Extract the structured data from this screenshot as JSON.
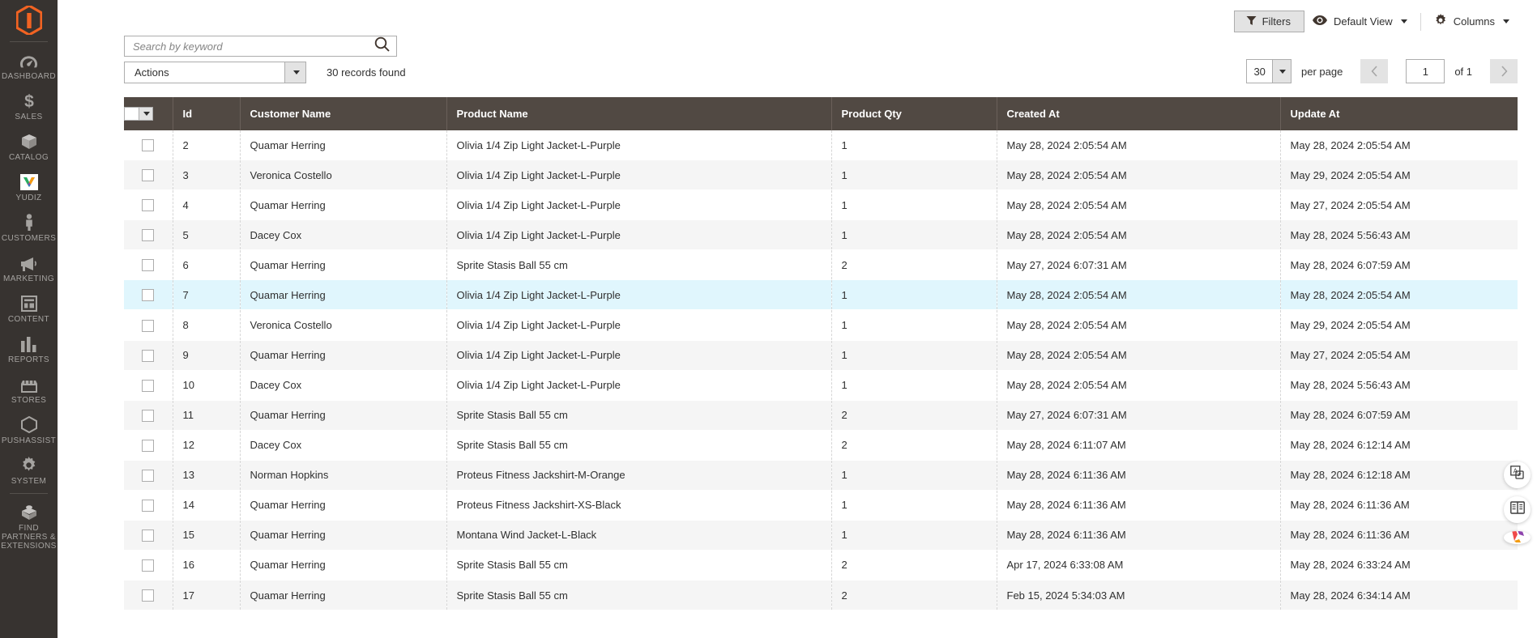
{
  "sidebar": {
    "logo": "magento-logo",
    "items": [
      {
        "label": "DASHBOARD",
        "icon": "dashboard-gauge-icon"
      },
      {
        "label": "SALES",
        "icon": "dollar-sign-icon"
      },
      {
        "label": "CATALOG",
        "icon": "box-icon"
      },
      {
        "label": "YUDIZ",
        "icon": "yudiz-logo-icon"
      },
      {
        "label": "CUSTOMERS",
        "icon": "person-icon"
      },
      {
        "label": "MARKETING",
        "icon": "megaphone-icon"
      },
      {
        "label": "CONTENT",
        "icon": "layout-panel-icon"
      },
      {
        "label": "REPORTS",
        "icon": "bar-chart-icon"
      },
      {
        "label": "STORES",
        "icon": "storefront-icon"
      },
      {
        "label": "PUSHASSIST",
        "icon": "hexagon-icon"
      },
      {
        "label": "SYSTEM",
        "icon": "gear-icon"
      },
      {
        "label": "FIND PARTNERS & EXTENSIONS",
        "icon": "extension-box-icon"
      }
    ]
  },
  "toolbar": {
    "filters_label": "Filters",
    "filters_icon": "funnel-icon",
    "view_label": "Default View",
    "view_icon": "eye-icon",
    "columns_label": "Columns",
    "columns_icon": "gear-icon"
  },
  "search": {
    "placeholder": "Search by keyword",
    "value": "",
    "icon": "search-icon"
  },
  "actions": {
    "label": "Actions",
    "records_found": "30 records found"
  },
  "pager": {
    "per_page_value": "30",
    "per_page_label": "per page",
    "prev_icon": "chevron-left-icon",
    "next_icon": "chevron-right-icon",
    "page_value": "1",
    "of_label": "of 1"
  },
  "grid": {
    "columns": [
      {
        "key": "cb",
        "label": ""
      },
      {
        "key": "id",
        "label": "Id"
      },
      {
        "key": "cust",
        "label": "Customer Name"
      },
      {
        "key": "prod",
        "label": "Product Name"
      },
      {
        "key": "qty",
        "label": "Product Qty"
      },
      {
        "key": "cre",
        "label": "Created At"
      },
      {
        "key": "upd",
        "label": "Update At"
      }
    ],
    "rows": [
      {
        "id": "2",
        "cust": "Quamar Herring",
        "prod": "Olivia 1/4 Zip Light Jacket-L-Purple",
        "qty": "1",
        "cre": "May 28, 2024 2:05:54 AM",
        "upd": "May 28, 2024 2:05:54 AM",
        "state": "odd"
      },
      {
        "id": "3",
        "cust": "Veronica Costello",
        "prod": "Olivia 1/4 Zip Light Jacket-L-Purple",
        "qty": "1",
        "cre": "May 28, 2024 2:05:54 AM",
        "upd": "May 29, 2024 2:05:54 AM",
        "state": "even"
      },
      {
        "id": "4",
        "cust": "Quamar Herring",
        "prod": "Olivia 1/4 Zip Light Jacket-L-Purple",
        "qty": "1",
        "cre": "May 28, 2024 2:05:54 AM",
        "upd": "May 27, 2024 2:05:54 AM",
        "state": "odd"
      },
      {
        "id": "5",
        "cust": "Dacey Cox",
        "prod": "Olivia 1/4 Zip Light Jacket-L-Purple",
        "qty": "1",
        "cre": "May 28, 2024 2:05:54 AM",
        "upd": "May 28, 2024 5:56:43 AM",
        "state": "even"
      },
      {
        "id": "6",
        "cust": "Quamar Herring",
        "prod": "Sprite Stasis Ball 55 cm",
        "qty": "2",
        "cre": "May 27, 2024 6:07:31 AM",
        "upd": "May 28, 2024 6:07:59 AM",
        "state": "odd"
      },
      {
        "id": "7",
        "cust": "Quamar Herring",
        "prod": "Olivia 1/4 Zip Light Jacket-L-Purple",
        "qty": "1",
        "cre": "May 28, 2024 2:05:54 AM",
        "upd": "May 28, 2024 2:05:54 AM",
        "state": "hl"
      },
      {
        "id": "8",
        "cust": "Veronica Costello",
        "prod": "Olivia 1/4 Zip Light Jacket-L-Purple",
        "qty": "1",
        "cre": "May 28, 2024 2:05:54 AM",
        "upd": "May 29, 2024 2:05:54 AM",
        "state": "odd"
      },
      {
        "id": "9",
        "cust": "Quamar Herring",
        "prod": "Olivia 1/4 Zip Light Jacket-L-Purple",
        "qty": "1",
        "cre": "May 28, 2024 2:05:54 AM",
        "upd": "May 27, 2024 2:05:54 AM",
        "state": "even"
      },
      {
        "id": "10",
        "cust": "Dacey Cox",
        "prod": "Olivia 1/4 Zip Light Jacket-L-Purple",
        "qty": "1",
        "cre": "May 28, 2024 2:05:54 AM",
        "upd": "May 28, 2024 5:56:43 AM",
        "state": "odd"
      },
      {
        "id": "11",
        "cust": "Quamar Herring",
        "prod": "Sprite Stasis Ball 55 cm",
        "qty": "2",
        "cre": "May 27, 2024 6:07:31 AM",
        "upd": "May 28, 2024 6:07:59 AM",
        "state": "even"
      },
      {
        "id": "12",
        "cust": "Dacey Cox",
        "prod": "Sprite Stasis Ball 55 cm",
        "qty": "2",
        "cre": "May 28, 2024 6:11:07 AM",
        "upd": "May 28, 2024 6:12:14 AM",
        "state": "odd"
      },
      {
        "id": "13",
        "cust": "Norman Hopkins",
        "prod": "Proteus Fitness Jackshirt-M-Orange",
        "qty": "1",
        "cre": "May 28, 2024 6:11:36 AM",
        "upd": "May 28, 2024 6:12:18 AM",
        "state": "even"
      },
      {
        "id": "14",
        "cust": "Quamar Herring",
        "prod": "Proteus Fitness Jackshirt-XS-Black",
        "qty": "1",
        "cre": "May 28, 2024 6:11:36 AM",
        "upd": "May 28, 2024 6:11:36 AM",
        "state": "odd"
      },
      {
        "id": "15",
        "cust": "Quamar Herring",
        "prod": "Montana Wind Jacket-L-Black",
        "qty": "1",
        "cre": "May 28, 2024 6:11:36 AM",
        "upd": "May 28, 2024 6:11:36 AM",
        "state": "even"
      },
      {
        "id": "16",
        "cust": "Quamar Herring",
        "prod": "Sprite Stasis Ball 55 cm",
        "qty": "2",
        "cre": "Apr 17, 2024 6:33:08 AM",
        "upd": "May 28, 2024 6:33:24 AM",
        "state": "odd"
      },
      {
        "id": "17",
        "cust": "Quamar Herring",
        "prod": "Sprite Stasis Ball 55 cm",
        "qty": "2",
        "cre": "Feb 15, 2024 5:34:03 AM",
        "upd": "May 28, 2024 6:34:14 AM",
        "state": "even"
      }
    ]
  },
  "floating": {
    "translate_icon": "translate-icon",
    "dictionary_icon": "book-icon",
    "extension_icon": "colorful-extension-icon"
  },
  "colors": {
    "sidebar_bg": "#373330",
    "header_bg": "#514943",
    "brand_orange": "#f26322",
    "row_highlight": "#e0f6fd",
    "row_alt": "#f5f5f5"
  }
}
